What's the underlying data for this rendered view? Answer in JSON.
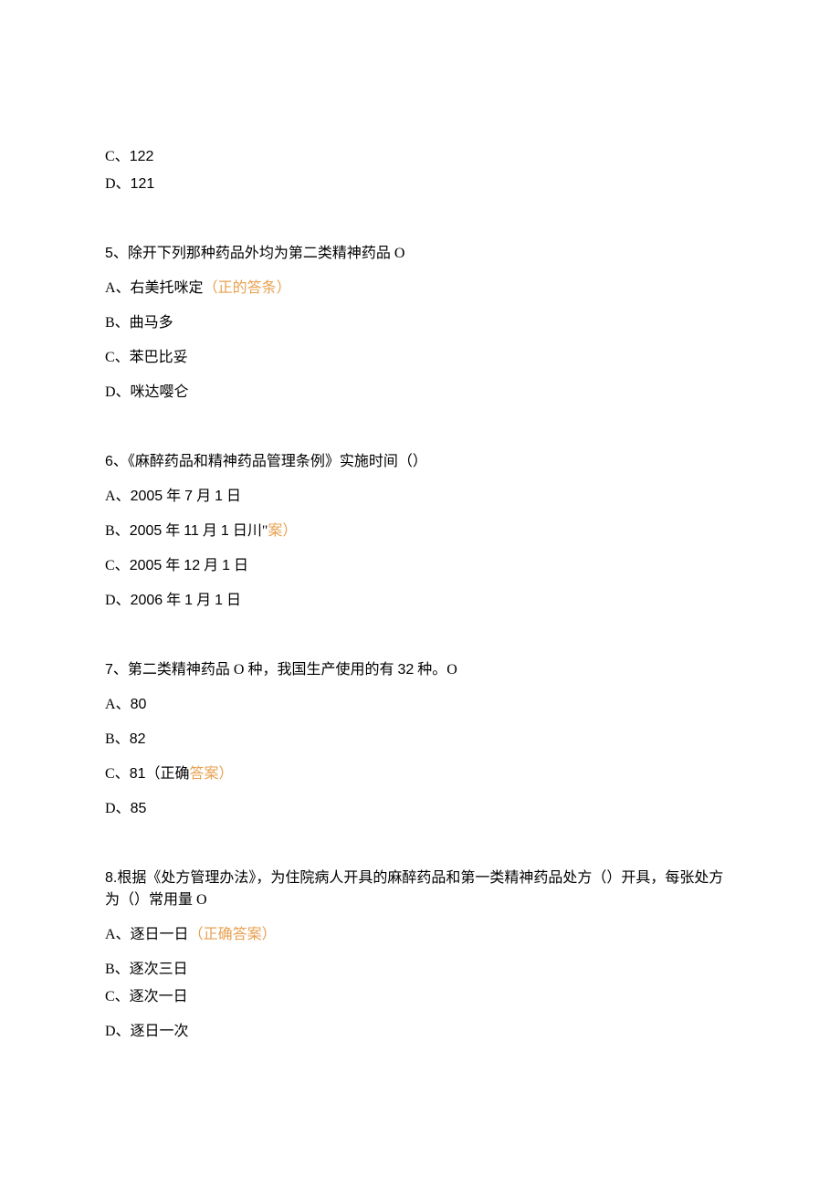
{
  "q4_tail": {
    "optC": "C、",
    "optC_num": "122",
    "optD": "D、",
    "optD_num": "121"
  },
  "q5": {
    "text_prefix": "5",
    "text": "、除开下列那种药品外均为第二类精神药品 O",
    "optA_label": "A、右美托咪定",
    "optA_hint": "（正的答条）",
    "optB": "B、曲马多",
    "optC": "C、苯巴比妥",
    "optD": "D、咪达嘤仑"
  },
  "q6": {
    "text_prefix": "6",
    "text": "、《麻醉药品和精神药品管理条例》实施时间（）",
    "optA_label": "A、",
    "optA_num": "2005",
    "optA_suffix": " 年 ",
    "optA_num2": "7",
    "optA_mid": " 月 ",
    "optA_num3": "1",
    "optA_end": " 日",
    "optB_label": "B、",
    "optB_num": "2005",
    "optB_suffix": " 年 ",
    "optB_num2": "11",
    "optB_mid": " 月 ",
    "optB_num3": "1",
    "optB_end": " 日川\"",
    "optB_hint": "案）",
    "optC_label": "C、",
    "optC_num": "2005",
    "optC_suffix": " 年 ",
    "optC_num2": "12",
    "optC_mid": " 月 ",
    "optC_num3": "1",
    "optC_end": " 日",
    "optD_label": "D、",
    "optD_num": "2006",
    "optD_suffix": " 年 ",
    "optD_num2": "1",
    "optD_mid": " 月 ",
    "optD_num3": "1",
    "optD_end": " 日"
  },
  "q7": {
    "text_prefix": "7",
    "text_a": "、第二类精神药品 O 种，我国生产使用的有 ",
    "text_num": "32",
    "text_b": " 种。O",
    "optA_label": "A、",
    "optA_num": "80",
    "optB_label": "B、",
    "optB_num": "82",
    "optC_label": "C、",
    "optC_num": "81",
    "optC_mid": "（正确",
    "optC_hint": "答案）",
    "optD_label": "D、",
    "optD_num": "85"
  },
  "q8": {
    "text_prefix": "8.",
    "text_a": "根据《处方管理办法》，为住院病人开具的麻醉药品和第一类精神药品处方（）开具，每张处方为（）常用量 O",
    "optA_label": "A、逐日一日",
    "optA_hint": "（正确答案）",
    "optB": "B、逐次三日",
    "optC": "C、逐次一日",
    "optD": "D、逐日一次"
  }
}
